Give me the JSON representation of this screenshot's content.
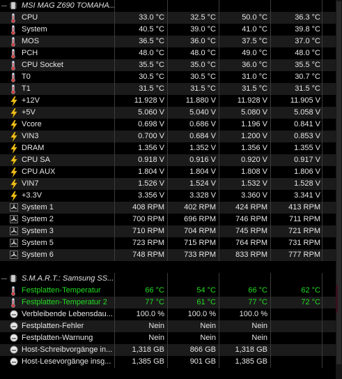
{
  "colors": {
    "accent_green": "#22dd22",
    "grid_line": "#3c3c3c",
    "row_alt": "#1b1b1b"
  },
  "sections": [
    {
      "header": "MSI MAG Z690 TOMAHA...",
      "rows": [
        {
          "icon": "thermometer-icon",
          "name": "CPU",
          "v": [
            "33.0 °C",
            "32.5 °C",
            "50.0 °C",
            "36.3 °C"
          ]
        },
        {
          "icon": "thermometer-icon",
          "name": "System",
          "v": [
            "40.5 °C",
            "39.0 °C",
            "41.0 °C",
            "39.8 °C"
          ]
        },
        {
          "icon": "thermometer-icon",
          "name": "MOS",
          "v": [
            "36.5 °C",
            "36.0 °C",
            "37.5 °C",
            "37.0 °C"
          ]
        },
        {
          "icon": "thermometer-icon",
          "name": "PCH",
          "v": [
            "48.0 °C",
            "48.0 °C",
            "49.0 °C",
            "48.0 °C"
          ]
        },
        {
          "icon": "thermometer-icon",
          "name": "CPU Socket",
          "v": [
            "35.5 °C",
            "35.0 °C",
            "36.0 °C",
            "35.5 °C"
          ]
        },
        {
          "icon": "thermometer-icon",
          "name": "T0",
          "v": [
            "30.5 °C",
            "30.5 °C",
            "31.0 °C",
            "30.7 °C"
          ]
        },
        {
          "icon": "thermometer-icon",
          "name": "T1",
          "v": [
            "31.5 °C",
            "31.5 °C",
            "31.5 °C",
            "31.5 °C"
          ]
        },
        {
          "icon": "lightning-icon",
          "name": "+12V",
          "v": [
            "11.928 V",
            "11.880 V",
            "11.928 V",
            "11.905 V"
          ]
        },
        {
          "icon": "lightning-icon",
          "name": "+5V",
          "v": [
            "5.060 V",
            "5.040 V",
            "5.080 V",
            "5.058 V"
          ]
        },
        {
          "icon": "lightning-icon",
          "name": "Vcore",
          "v": [
            "0.698 V",
            "0.686 V",
            "1.196 V",
            "0.841 V"
          ]
        },
        {
          "icon": "lightning-icon",
          "name": "VIN3",
          "v": [
            "0.700 V",
            "0.684 V",
            "1.200 V",
            "0.853 V"
          ]
        },
        {
          "icon": "lightning-icon",
          "name": "DRAM",
          "v": [
            "1.356 V",
            "1.352 V",
            "1.356 V",
            "1.355 V"
          ]
        },
        {
          "icon": "lightning-icon",
          "name": "CPU SA",
          "v": [
            "0.918 V",
            "0.916 V",
            "0.920 V",
            "0.917 V"
          ]
        },
        {
          "icon": "lightning-icon",
          "name": "CPU AUX",
          "v": [
            "1.804 V",
            "1.804 V",
            "1.808 V",
            "1.806 V"
          ]
        },
        {
          "icon": "lightning-icon",
          "name": "VIN7",
          "v": [
            "1.526 V",
            "1.524 V",
            "1.532 V",
            "1.528 V"
          ]
        },
        {
          "icon": "lightning-icon",
          "name": "+3.3V",
          "v": [
            "3.356 V",
            "3.328 V",
            "3.360 V",
            "3.341 V"
          ]
        },
        {
          "icon": "fan-icon",
          "name": "System 1",
          "v": [
            "408 RPM",
            "402 RPM",
            "424 RPM",
            "413 RPM"
          ]
        },
        {
          "icon": "fan-icon",
          "name": "System 2",
          "v": [
            "700 RPM",
            "696 RPM",
            "746 RPM",
            "711 RPM"
          ]
        },
        {
          "icon": "fan-icon",
          "name": "System 3",
          "v": [
            "710 RPM",
            "704 RPM",
            "745 RPM",
            "721 RPM"
          ]
        },
        {
          "icon": "fan-icon",
          "name": "System 5",
          "v": [
            "723 RPM",
            "715 RPM",
            "764 RPM",
            "731 RPM"
          ]
        },
        {
          "icon": "fan-icon",
          "name": "System 6",
          "v": [
            "748 RPM",
            "733 RPM",
            "833 RPM",
            "777 RPM"
          ]
        }
      ]
    },
    {
      "header": "S.M.A.R.T.: Samsung SS...",
      "rows": [
        {
          "icon": "thermometer-icon",
          "name": "Festplatten-Temperatur",
          "v": [
            "66 °C",
            "54 °C",
            "66 °C",
            "62 °C"
          ],
          "green": true
        },
        {
          "icon": "thermometer-icon",
          "name": "Festplatten-Temperatur 2",
          "v": [
            "77 °C",
            "61 °C",
            "77 °C",
            "72 °C"
          ],
          "green": true,
          "highlight": true
        },
        {
          "icon": "gauge-icon",
          "name": "Verbleibende Lebensdau...",
          "v": [
            "100.0 %",
            "100.0 %",
            "100.0 %",
            ""
          ]
        },
        {
          "icon": "gauge-icon",
          "name": "Festplatten-Fehler",
          "v": [
            "Nein",
            "Nein",
            "Nein",
            ""
          ]
        },
        {
          "icon": "gauge-icon",
          "name": "Festplatten-Warnung",
          "v": [
            "Nein",
            "Nein",
            "Nein",
            ""
          ]
        },
        {
          "icon": "gauge-icon",
          "name": "Host-Schreibvorgänge in...",
          "v": [
            "1,318 GB",
            "866 GB",
            "1,318 GB",
            ""
          ]
        },
        {
          "icon": "gauge-icon",
          "name": "Host-Lesevorgänge insg...",
          "v": [
            "1,385 GB",
            "901 GB",
            "1,385 GB",
            ""
          ]
        }
      ]
    }
  ]
}
